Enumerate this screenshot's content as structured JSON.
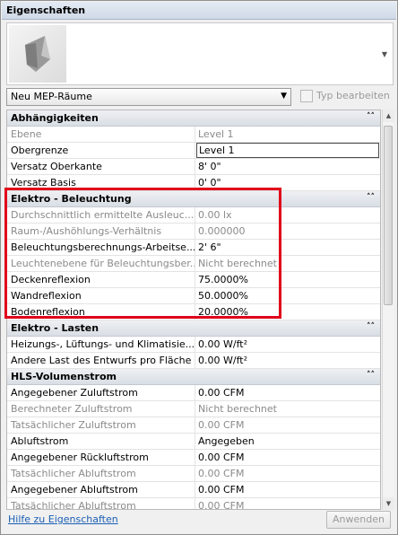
{
  "window": {
    "title": "Eigenschaften"
  },
  "type_selector": {
    "value": "Neu MEP-Räume",
    "edit_type_label": "Typ bearbeiten"
  },
  "groups": [
    {
      "title": "Abhängigkeiten",
      "rows": [
        {
          "name": "Ebene",
          "value": "Level 1",
          "readonly": true
        },
        {
          "name": "Obergrenze",
          "value": "Level 1",
          "readonly": false,
          "boxed": true
        },
        {
          "name": "Versatz Oberkante",
          "value": "8'  0\"",
          "readonly": false
        },
        {
          "name": "Versatz Basis",
          "value": "0'  0\"",
          "readonly": false
        }
      ]
    },
    {
      "title": "Elektro - Beleuchtung",
      "rows": [
        {
          "name": "Durchschnittlich ermittelte Ausleuc...",
          "value": "0.00 lx",
          "readonly": true
        },
        {
          "name": "Raum-/Aushöhlungs-Verhältnis",
          "value": "0.000000",
          "readonly": true
        },
        {
          "name": "Beleuchtungsberechnungs-Arbeitse...",
          "value": "2'  6\"",
          "readonly": false
        },
        {
          "name": "Leuchtenebene für Beleuchtungsber...",
          "value": "Nicht berechnet",
          "readonly": true
        },
        {
          "name": "Deckenreflexion",
          "value": "75.0000%",
          "readonly": false
        },
        {
          "name": "Wandreflexion",
          "value": "50.0000%",
          "readonly": false
        },
        {
          "name": "Bodenreflexion",
          "value": "20.0000%",
          "readonly": false
        }
      ]
    },
    {
      "title": "Elektro - Lasten",
      "rows": [
        {
          "name": "Heizungs-, Lüftungs- und Klimatisie...",
          "value": "0.00 W/ft²",
          "readonly": false
        },
        {
          "name": "Andere Last des Entwurfs pro Fläche",
          "value": "0.00 W/ft²",
          "readonly": false
        }
      ]
    },
    {
      "title": "HLS-Volumenstrom",
      "rows": [
        {
          "name": "Angegebener Zuluftstrom",
          "value": "0.00 CFM",
          "readonly": false
        },
        {
          "name": "Berechneter Zuluftstrom",
          "value": "Nicht berechnet",
          "readonly": true
        },
        {
          "name": "Tatsächlicher Zuluftstrom",
          "value": "0.00 CFM",
          "readonly": true
        },
        {
          "name": "Abluftstrom",
          "value": "Angegeben",
          "readonly": false
        },
        {
          "name": "Angegebener Rückluftstrom",
          "value": "0.00 CFM",
          "readonly": false
        },
        {
          "name": "Tatsächlicher Abluftstrom",
          "value": "0.00 CFM",
          "readonly": true
        },
        {
          "name": "Angegebener Abluftstrom",
          "value": "0.00 CFM",
          "readonly": false
        },
        {
          "name": "Tatsächlicher Abluftstrom",
          "value": "0.00 CFM",
          "readonly": true
        }
      ]
    }
  ],
  "footer": {
    "help_link": "Hilfe zu Eigenschaften",
    "apply_label": "Anwenden"
  },
  "icons": {
    "collapse": "double-chevron-up-icon",
    "dropdown": "chevron-down-icon",
    "edit_type": "edit-type-icon"
  },
  "colors": {
    "highlight_frame": "#e0001a",
    "link": "#1a5fb4"
  }
}
